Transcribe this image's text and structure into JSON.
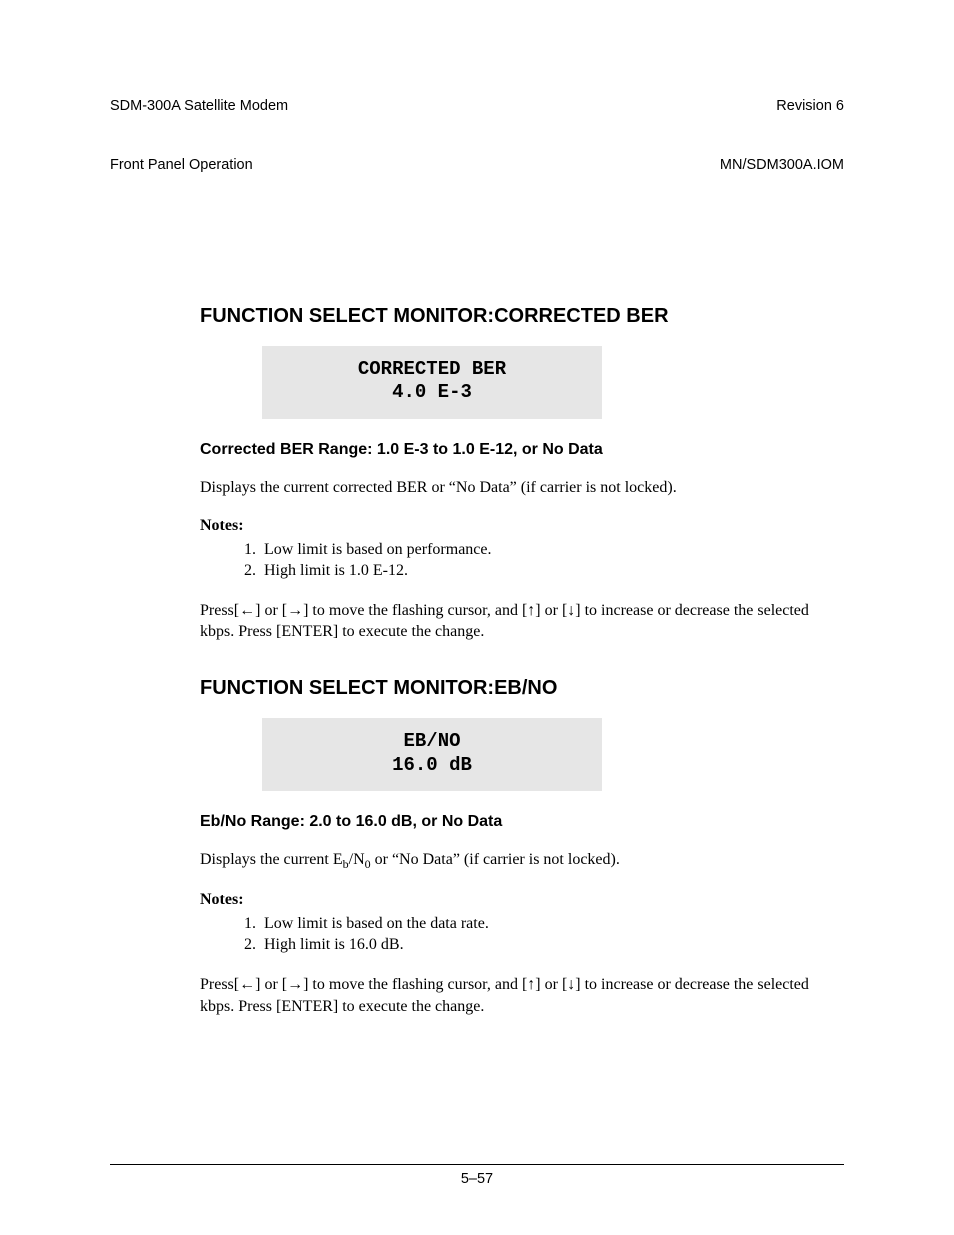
{
  "header": {
    "left_line1": "SDM-300A Satellite Modem",
    "left_line2": "Front Panel Operation",
    "right_line1": "Revision 6",
    "right_line2": "MN/SDM300A.IOM"
  },
  "section1": {
    "title": "FUNCTION SELECT MONITOR:CORRECTED BER",
    "lcd_line1": "CORRECTED BER",
    "lcd_line2": "4.0  E-3",
    "range": "Corrected BER Range: 1.0 E-3 to 1.0 E-12, or No Data",
    "desc": "Displays the current corrected BER or “No Data” (if carrier is not locked).",
    "notes_label": "Notes:",
    "note1": "Low limit is based on performance.",
    "note2": "High limit is 1.0 E-12.",
    "instr": "Press[←] or [→] to move the flashing cursor, and [↑] or [↓] to increase or decrease the selected kbps. Press [ENTER] to execute the change."
  },
  "section2": {
    "title": "FUNCTION SELECT MONITOR:EB/NO",
    "lcd_line1": "EB/NO",
    "lcd_line2": "16.0 dB",
    "range": "Eb/No Range: 2.0 to 16.0 dB, or No Data",
    "desc_pre": "Displays the current E",
    "desc_b": "b",
    "desc_mid": "/N",
    "desc_0": "0",
    "desc_post": " or “No Data” (if carrier is not locked).",
    "notes_label": "Notes:",
    "note1": "Low limit is based on the data rate.",
    "note2": "High limit is 16.0 dB.",
    "instr": "Press[←] or [→] to move the flashing cursor, and [↑] or [↓] to increase or decrease the selected kbps. Press [ENTER] to execute the change."
  },
  "footer": {
    "page": "5–57"
  }
}
